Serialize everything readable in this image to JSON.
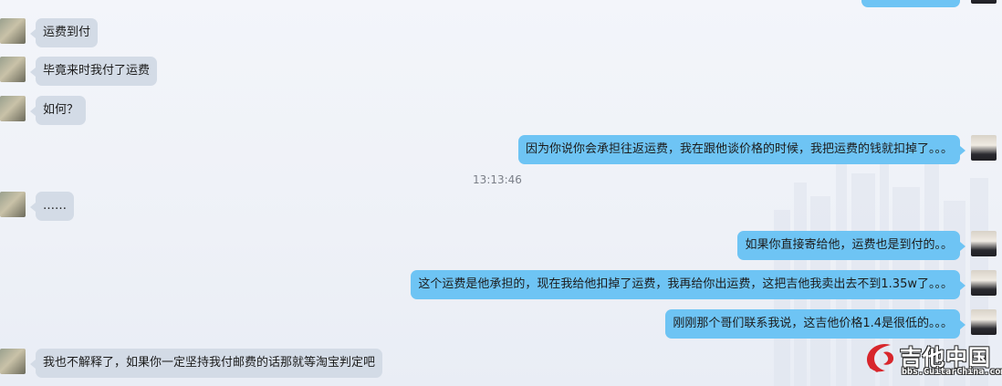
{
  "messages": [
    {
      "side": "left",
      "text": "运费到付"
    },
    {
      "side": "left",
      "text": "毕竟来时我付了运费"
    },
    {
      "side": "left",
      "text": "如何？"
    },
    {
      "side": "right",
      "text": "因为你说你会承担往返运费，我在跟他谈价格的时候，我把运费的钱就扣掉了。。。"
    },
    {
      "side": "left",
      "text": "……"
    },
    {
      "side": "right",
      "text": "如果你直接寄给他，运费也是到付的。。"
    },
    {
      "side": "right",
      "text": "这个运费是他承担的，现在我给他扣掉了运费，我再给你出运费，这把吉他我卖出去不到1.35w了。。。"
    },
    {
      "side": "right",
      "text": "刚刚那个哥们联系我说，这吉他价格1.4是很低的。。。"
    },
    {
      "side": "left",
      "text": "我也不解释了，如果你一定坚持我付邮费的话那就等淘宝判定吧"
    }
  ],
  "timestamp": "13:13:46",
  "watermark": {
    "title": "吉他中国",
    "url": "bbs.GuitarChina.com"
  },
  "colors": {
    "incoming_bubble": "#d3dbe6",
    "outgoing_bubble": "#6ec4f4",
    "background": "#eef1f7"
  }
}
